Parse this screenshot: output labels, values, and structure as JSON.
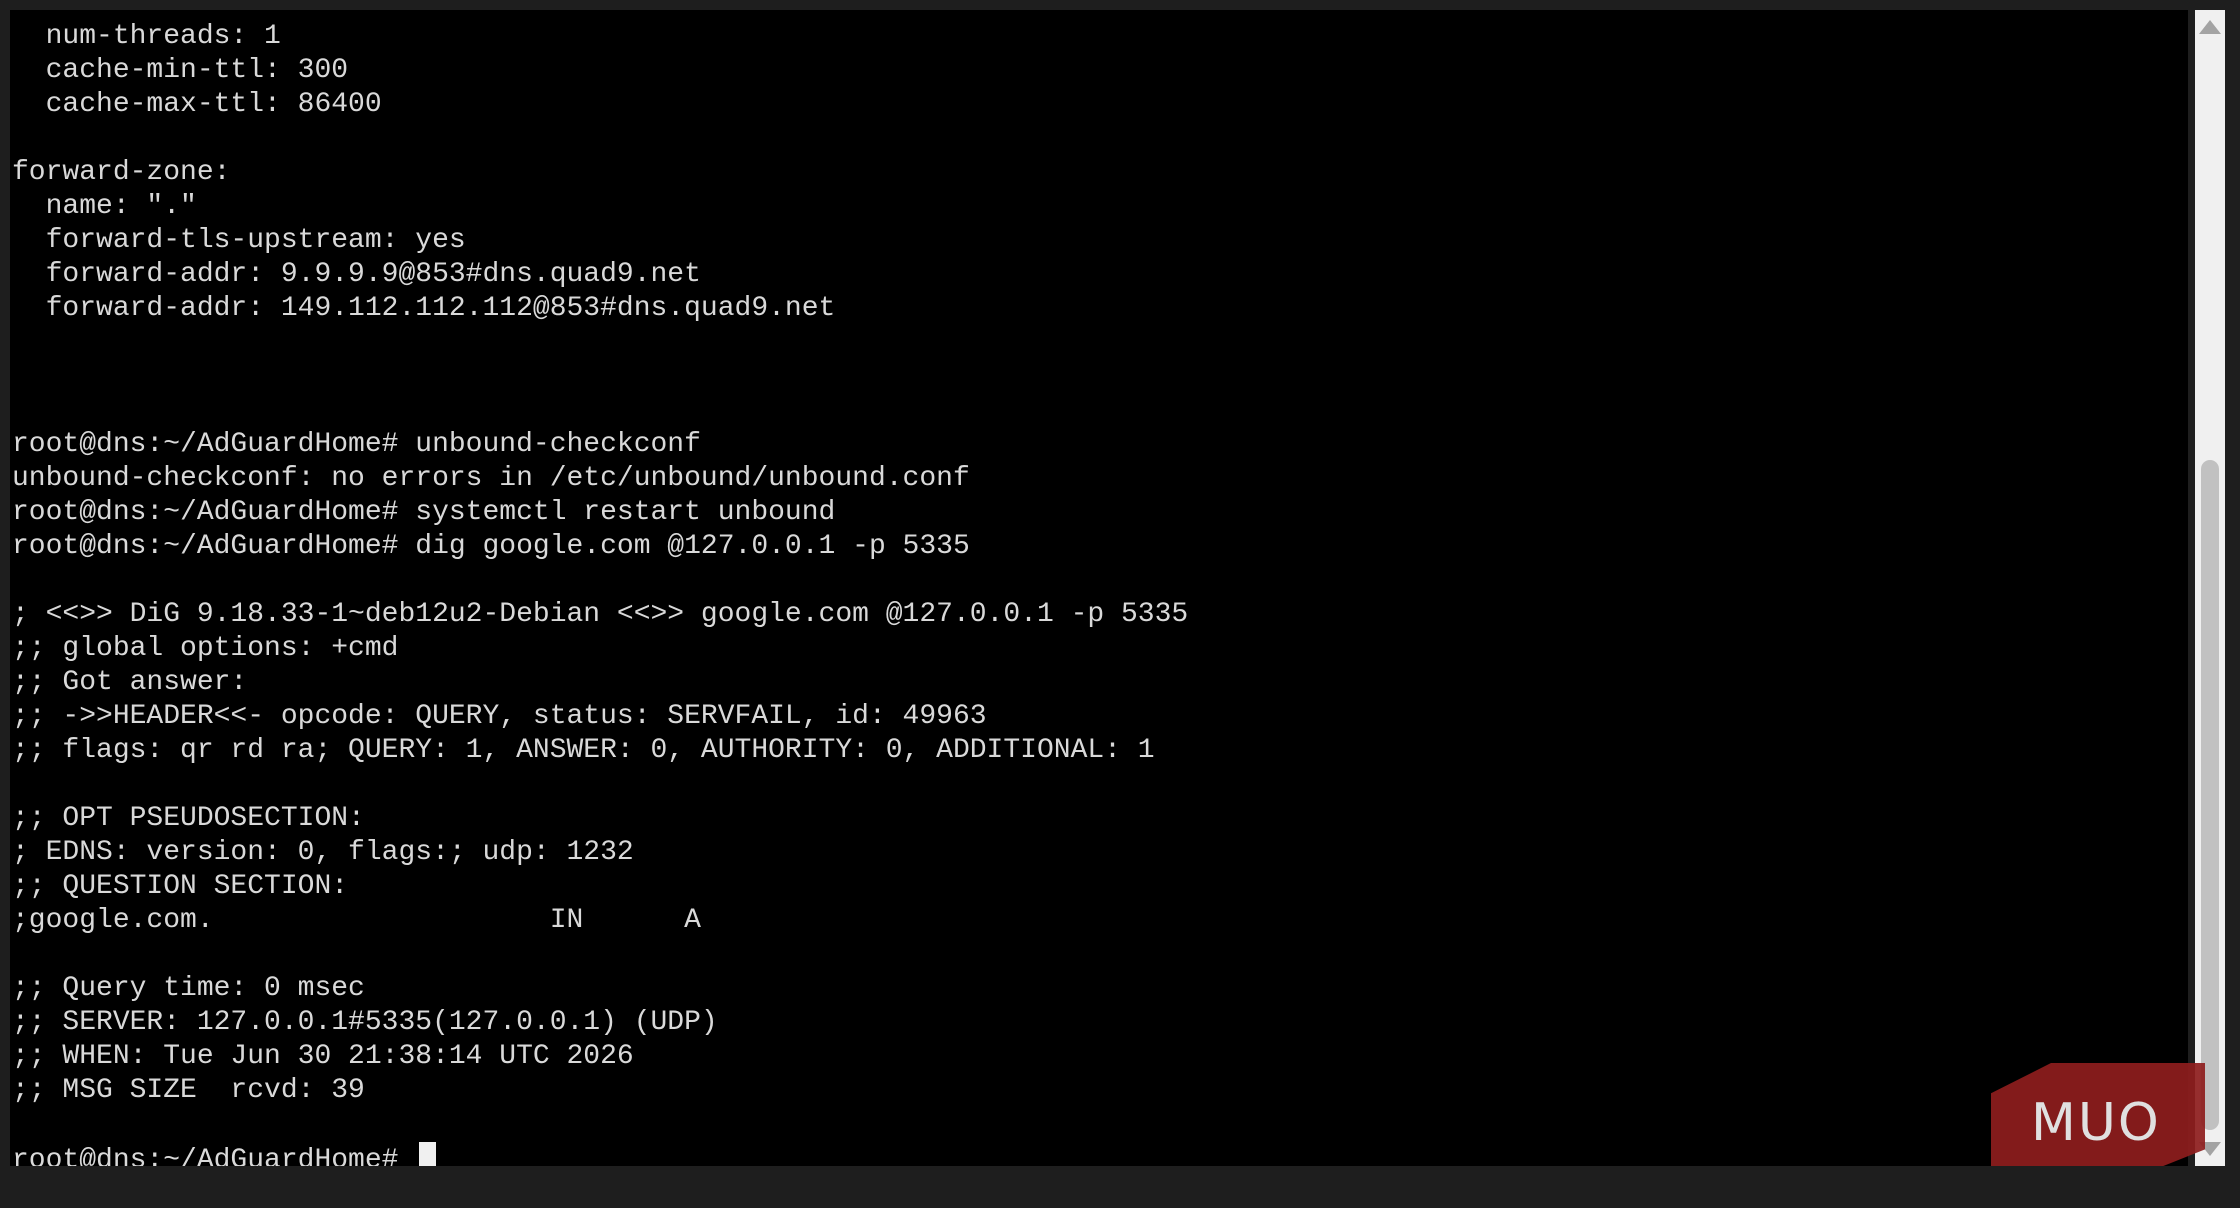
{
  "terminal": {
    "lines": [
      "  num-threads: 1",
      "  cache-min-ttl: 300",
      "  cache-max-ttl: 86400",
      "",
      "forward-zone:",
      "  name: \".\"",
      "  forward-tls-upstream: yes",
      "  forward-addr: 9.9.9.9@853#dns.quad9.net",
      "  forward-addr: 149.112.112.112@853#dns.quad9.net",
      "",
      "",
      "",
      "root@dns:~/AdGuardHome# unbound-checkconf",
      "unbound-checkconf: no errors in /etc/unbound/unbound.conf",
      "root@dns:~/AdGuardHome# systemctl restart unbound",
      "root@dns:~/AdGuardHome# dig google.com @127.0.0.1 -p 5335",
      "",
      "; <<>> DiG 9.18.33-1~deb12u2-Debian <<>> google.com @127.0.0.1 -p 5335",
      ";; global options: +cmd",
      ";; Got answer:",
      ";; ->>HEADER<<- opcode: QUERY, status: SERVFAIL, id: 49963",
      ";; flags: qr rd ra; QUERY: 1, ANSWER: 0, AUTHORITY: 0, ADDITIONAL: 1",
      "",
      ";; OPT PSEUDOSECTION:",
      "; EDNS: version: 0, flags:; udp: 1232",
      ";; QUESTION SECTION:",
      ";google.com.                    IN      A",
      "",
      ";; Query time: 0 msec",
      ";; SERVER: 127.0.0.1#5335(127.0.0.1) (UDP)",
      ";; WHEN: Tue Jun 30 21:38:14 UTC 2026",
      ";; MSG SIZE  rcvd: 39",
      ""
    ],
    "prompt": "root@dns:~/AdGuardHome# "
  },
  "watermark": {
    "text": "MUO",
    "color": "#8f1e1e"
  },
  "icons": {
    "scroll_up": "arrow-up-icon",
    "scroll_down": "arrow-down-icon"
  }
}
